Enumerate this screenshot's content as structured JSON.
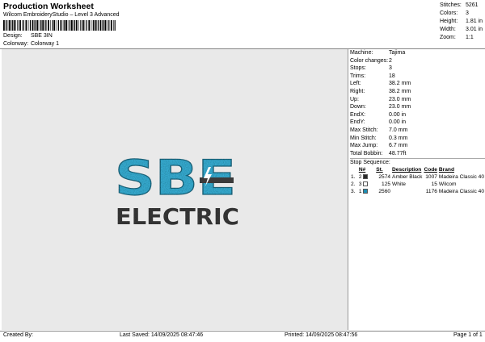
{
  "header": {
    "title": "Production Worksheet",
    "subtitle": "Wilcom EmbroideryStudio – Level 3 Advanced",
    "design_label": "Design:",
    "design_value": "SBE 3IN",
    "colorway_label": "Colorway:",
    "colorway_value": "Colorway 1"
  },
  "top_stats": [
    {
      "k": "Stitches:",
      "v": "5261"
    },
    {
      "k": "Colors:",
      "v": "3"
    },
    {
      "k": "Height:",
      "v": "1.81 in"
    },
    {
      "k": "Width:",
      "v": "3.01 in"
    },
    {
      "k": "Zoom:",
      "v": "1:1"
    }
  ],
  "machine_stats": [
    {
      "k": "Machine:",
      "v": "Tajima"
    },
    {
      "k": "Color changes:",
      "v": "2"
    },
    {
      "k": "Stops:",
      "v": "3"
    },
    {
      "k": "Trims:",
      "v": "18"
    },
    {
      "k": "Left:",
      "v": "38.2 mm"
    },
    {
      "k": "Right:",
      "v": "38.2 mm"
    },
    {
      "k": "Up:",
      "v": "23.0 mm"
    },
    {
      "k": "Down:",
      "v": "23.0 mm"
    },
    {
      "k": "EndX:",
      "v": "0.00 in"
    },
    {
      "k": "EndY:",
      "v": "0.00 in"
    },
    {
      "k": "Max Stitch:",
      "v": "7.0 mm"
    },
    {
      "k": "Min Stitch:",
      "v": "0.3 mm"
    },
    {
      "k": "Max Jump:",
      "v": "6.7 mm"
    },
    {
      "k": "Total Bobbin:",
      "v": "48.77ft"
    }
  ],
  "stop_sequence": {
    "title": "Stop Sequence:",
    "headers": [
      "N#",
      "St.",
      "Description",
      "Code",
      "Brand"
    ],
    "rows": [
      {
        "idx": "1.",
        "n": "2",
        "color": "#2a2a2a",
        "st": "2574",
        "desc": "Amber Black",
        "code": "1007",
        "brand": "Madeira Classic 40"
      },
      {
        "idx": "2.",
        "n": "3",
        "color": "#ffffff",
        "st": "125",
        "desc": "White",
        "code": "15",
        "brand": "Wilcom"
      },
      {
        "idx": "3.",
        "n": "1",
        "color": "#1e8fb5",
        "st": "2560",
        "desc": "",
        "code": "1176",
        "brand": "Madeira Classic 40"
      }
    ]
  },
  "footer": {
    "created": "Created By:",
    "last_saved": "Last Saved: 14/09/2025 08:47:46",
    "printed": "Printed: 14/09/2025 08:47:56",
    "page": "Page 1 of 1"
  },
  "logo": {
    "line1": "SBE",
    "line2": "ELECTRIC",
    "blue": "#39b6dd",
    "dark": "#3b3b3b"
  }
}
